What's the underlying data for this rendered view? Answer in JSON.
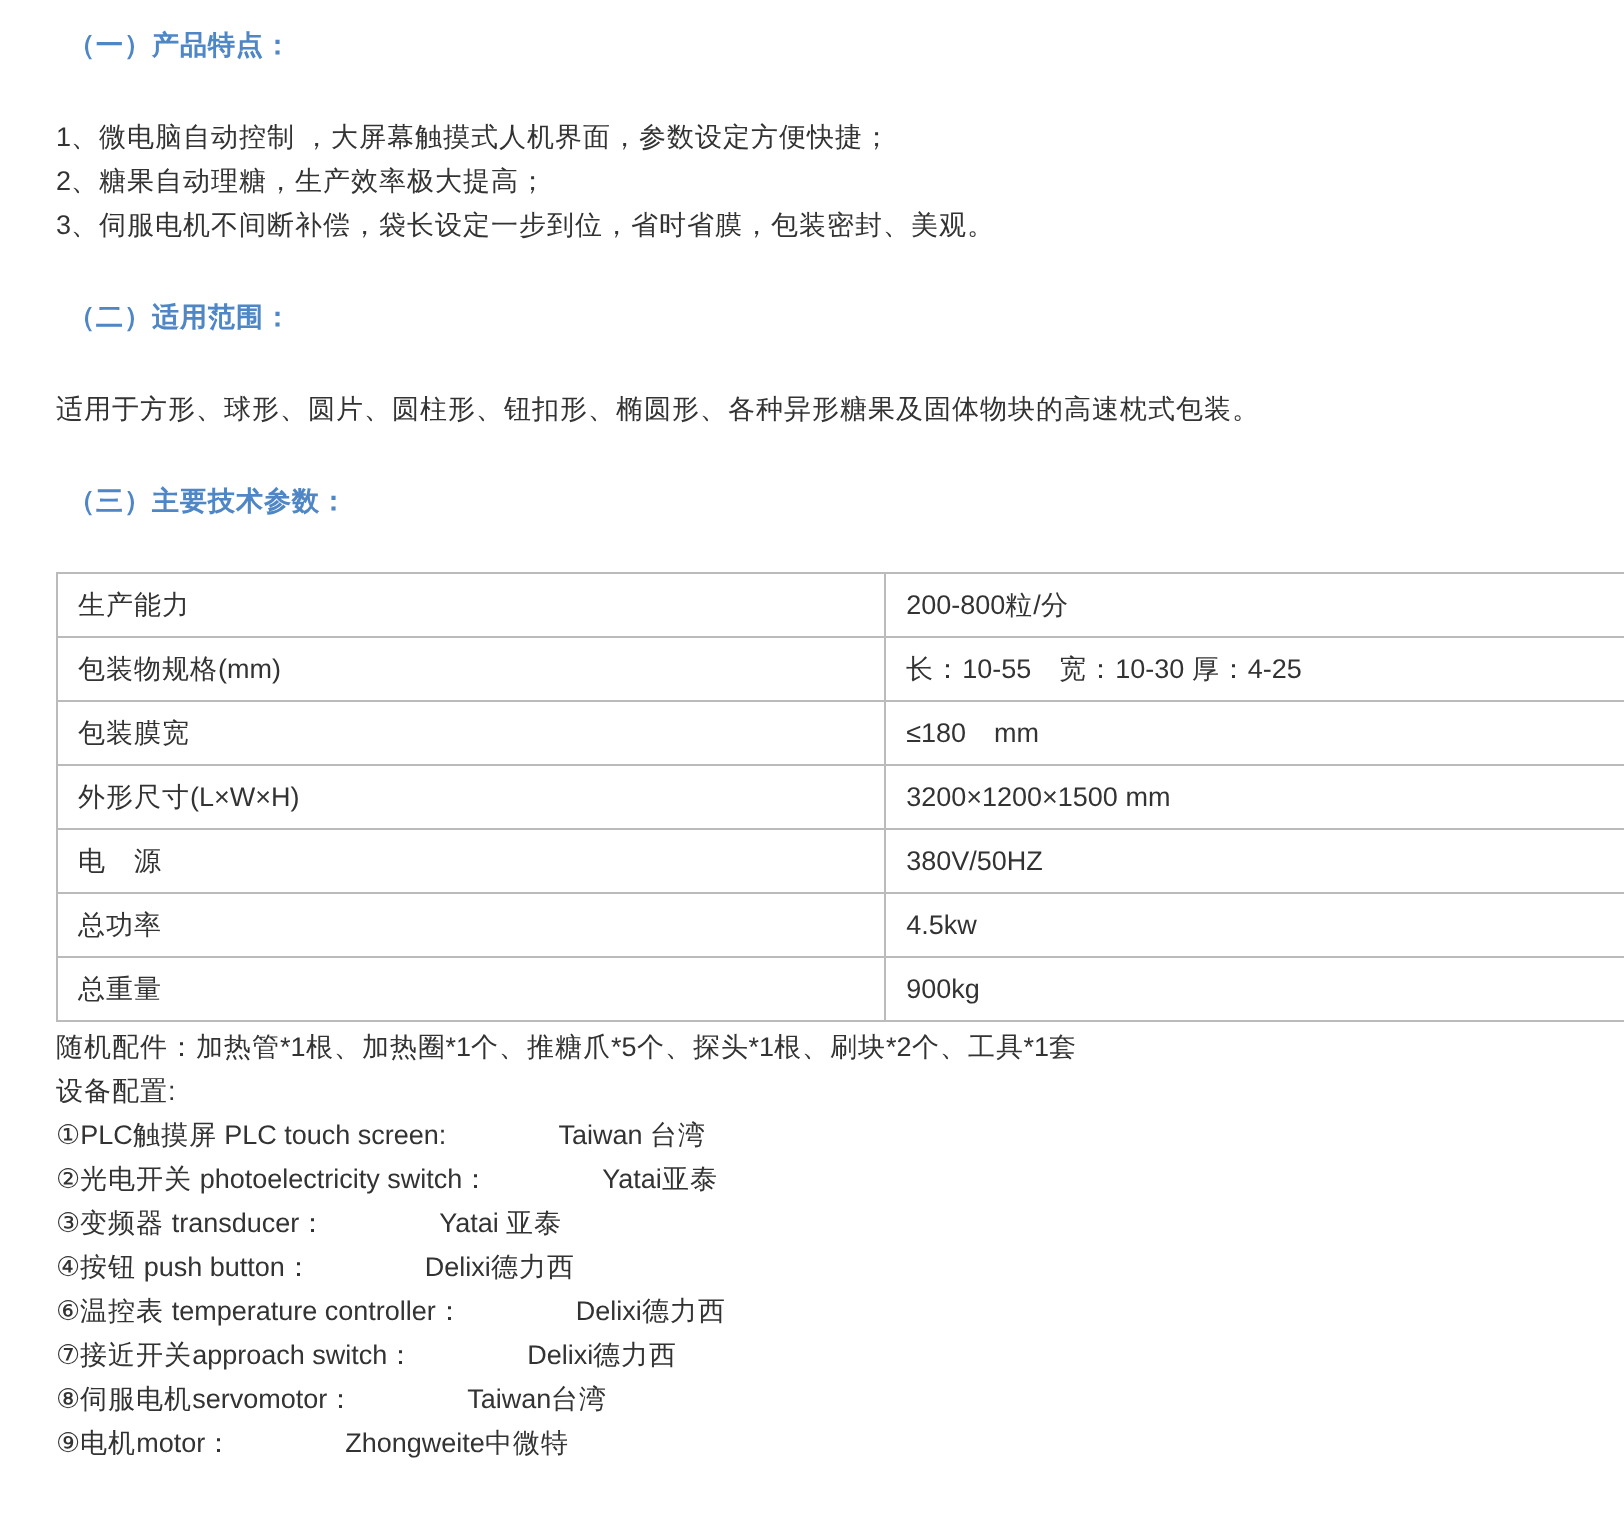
{
  "sections": [
    {
      "heading": "（一）产品特点：",
      "kind": "list",
      "lines": [
        "1、微电脑自动控制 ，大屏幕触摸式人机界面，参数设定方便快捷；",
        "2、糖果自动理糖，生产效率极大提高；",
        "3、伺服电机不间断补偿，袋长设定一步到位，省时省膜，包装密封、美观。"
      ]
    },
    {
      "heading": "（二）适用范围：",
      "kind": "paragraph",
      "lines": [
        "适用于方形、球形、圆片、圆柱形、钮扣形、椭圆形、各种异形糖果及固体物块的高速枕式包装。"
      ]
    },
    {
      "heading": "（三）主要技术参数：",
      "kind": "table",
      "rows": [
        [
          "生产能力",
          "200-800粒/分"
        ],
        [
          "包装物规格(mm)",
          "长：10-55　宽：10-30 厚：4-25"
        ],
        [
          "包装膜宽",
          "≤180　mm"
        ],
        [
          "外形尺寸(L×W×H)",
          "3200×1200×1500 mm"
        ],
        [
          "电　源",
          "380V/50HZ"
        ],
        [
          "总功率",
          "4.5kw"
        ],
        [
          "总重量",
          "900kg"
        ]
      ]
    }
  ],
  "accessories": "随机配件：加热管*1根、加热圈*1个、推糖爪*5个、探头*1根、刷块*2个、工具*1套",
  "config_title": "设备配置:",
  "config": [
    {
      "label": "①PLC触摸屏 PLC touch screen:",
      "value": "Taiwan 台湾"
    },
    {
      "label": "②光电开关 photoelectricity switch：",
      "value": "Yatai亚泰"
    },
    {
      "label": "③变频器 transducer：",
      "value": "Yatai 亚泰"
    },
    {
      "label": "④按钮 push button：",
      "value": "Delixi德力西"
    },
    {
      "label": "⑥温控表 temperature controller：",
      "value": "Delixi德力西"
    },
    {
      "label": "⑦接近开关approach switch：",
      "value": "Delixi德力西"
    },
    {
      "label": "⑧伺服电机servomotor：",
      "value": "Taiwan台湾"
    },
    {
      "label": "⑨电机motor：",
      "value": "Zhongweite中微特"
    }
  ]
}
